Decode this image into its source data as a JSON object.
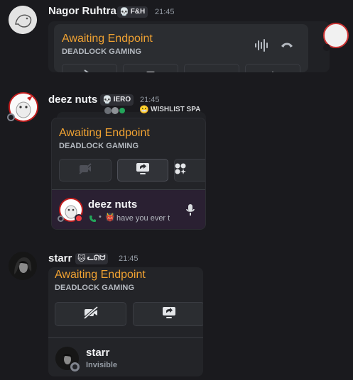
{
  "messages": [
    {
      "author": "Nagor Ruhtra",
      "tag_glyph": "💀",
      "tag_text": "F&H",
      "time": "21:45",
      "card": {
        "title": "Awaiting Endpoint",
        "subtitle": "DEADLOCK GAMING"
      }
    },
    {
      "author": "deez nuts",
      "tag_glyph": "💀",
      "tag_text": "IERO",
      "time": "21:45",
      "peek_text": "WISHLIST SPA",
      "card": {
        "title": "Awaiting Endpoint",
        "subtitle": "DEADLOCK GAMING"
      },
      "user": {
        "name": "deez nuts",
        "status": "have you ever t"
      }
    },
    {
      "author": "starr",
      "tag_glyph": "🐱",
      "tag_text": "ᓚᘏᗢ",
      "time": "21:45",
      "card": {
        "title": "Awaiting Endpoint",
        "subtitle": "DEADLOCK GAMING"
      },
      "user": {
        "name": "starr",
        "status": "Invisible"
      }
    }
  ],
  "colors": {
    "accent_orange": "#f0a232",
    "background": "#1a1a1e",
    "card": "#232428",
    "user_row_purple": "#2a2032",
    "offline_grey": "#80848e",
    "dnd_red": "#f23f43",
    "online_green": "#23a55a"
  },
  "icons": {
    "waveform": "waveform-icon",
    "hangup": "phone-hangup-icon",
    "camera_off": "camera-off-icon",
    "screen_share": "screen-share-icon",
    "activities": "activities-icon",
    "microphone": "microphone-icon",
    "phone": "phone-icon"
  }
}
